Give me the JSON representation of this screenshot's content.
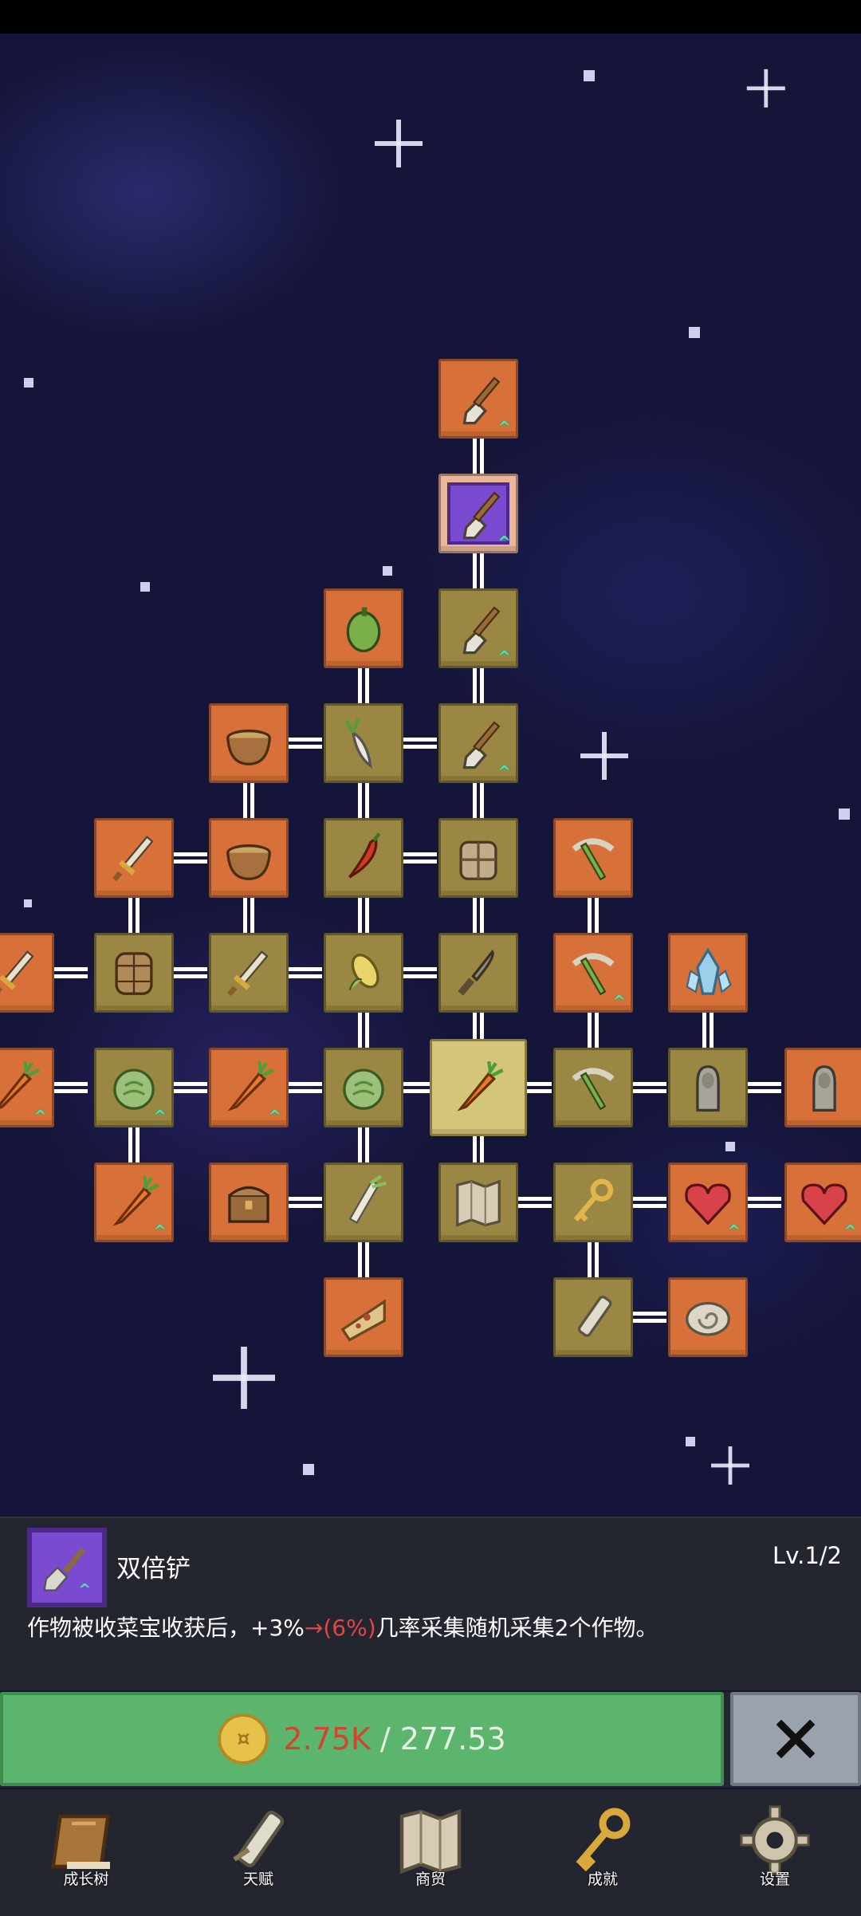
{
  "colors": {
    "node_orange": "#d8703a",
    "node_tan": "#9a8743",
    "node_selected": "#d5c57a",
    "node_purple": "#7a4ad0",
    "buy_green": "#5bb56d",
    "cost_red": "#d4432f",
    "highlight_red": "#e04646",
    "close_gray": "#9aa3ad"
  },
  "selected_skill": {
    "icon": "shovel-icon",
    "name": "双倍铲",
    "level": "Lv.1/2",
    "desc_prefix": "作物被收菜宝收获后，+3%",
    "desc_arrow": "→",
    "desc_highlight": "(6%)",
    "desc_suffix": "几率采集随机采集2个作物。"
  },
  "purchase": {
    "icon": "coin-icon",
    "owned": "2.75K",
    "separator": "/",
    "price": "277.53",
    "close_icon": "close-x-icon"
  },
  "nav": [
    {
      "label": "成长树",
      "icon": "book-icon"
    },
    {
      "label": "天赋",
      "icon": "scroll-icon"
    },
    {
      "label": "商贸",
      "icon": "map-icon"
    },
    {
      "label": "成就",
      "icon": "key-icon"
    },
    {
      "label": "设置",
      "icon": "gear-icon"
    }
  ],
  "tree_nodes": [
    {
      "icon": "shovel-icon",
      "color": "orange",
      "upgrade": true
    },
    {
      "icon": "shovel-icon",
      "color": "purple",
      "upgrade": true
    },
    {
      "icon": "pepper-icon",
      "color": "orange",
      "upgrade": false
    },
    {
      "icon": "shovel-icon",
      "color": "tan",
      "upgrade": true
    },
    {
      "icon": "bowl-icon",
      "color": "orange",
      "upgrade": false
    },
    {
      "icon": "radish-icon",
      "color": "tan",
      "upgrade": false
    },
    {
      "icon": "shovel-icon",
      "color": "tan",
      "upgrade": true
    },
    {
      "icon": "sword-icon",
      "color": "orange",
      "upgrade": false
    },
    {
      "icon": "bowl-icon",
      "color": "orange",
      "upgrade": false
    },
    {
      "icon": "chili-icon",
      "color": "tan",
      "upgrade": false
    },
    {
      "icon": "backpack-icon",
      "color": "tan",
      "upgrade": false
    },
    {
      "icon": "pickaxe-icon",
      "color": "orange",
      "upgrade": false
    },
    {
      "icon": "sword-icon",
      "color": "orange",
      "upgrade": false
    },
    {
      "icon": "barrel-icon",
      "color": "tan",
      "upgrade": false
    },
    {
      "icon": "sword-icon",
      "color": "tan",
      "upgrade": false
    },
    {
      "icon": "corn-icon",
      "color": "tan",
      "upgrade": false
    },
    {
      "icon": "knife-icon",
      "color": "tan",
      "upgrade": false
    },
    {
      "icon": "pickaxe-icon",
      "color": "orange",
      "upgrade": true
    },
    {
      "icon": "crystal-icon",
      "color": "orange",
      "upgrade": false
    },
    {
      "icon": "carrot-icon",
      "color": "orange",
      "upgrade": true
    },
    {
      "icon": "cabbage-icon",
      "color": "tan",
      "upgrade": true
    },
    {
      "icon": "carrot-icon",
      "color": "orange",
      "upgrade": true
    },
    {
      "icon": "cabbage-icon",
      "color": "tan",
      "upgrade": false
    },
    {
      "icon": "carrot-icon",
      "color": "selected",
      "upgrade": false
    },
    {
      "icon": "pickaxe-icon",
      "color": "tan",
      "upgrade": false
    },
    {
      "icon": "statue-icon",
      "color": "tan",
      "upgrade": false
    },
    {
      "icon": "statue-icon",
      "color": "orange",
      "upgrade": false
    },
    {
      "icon": "carrot-icon",
      "color": "orange",
      "upgrade": true
    },
    {
      "icon": "chest-icon",
      "color": "orange",
      "upgrade": false
    },
    {
      "icon": "leek-icon",
      "color": "tan",
      "upgrade": false
    },
    {
      "icon": "map-icon",
      "color": "tan",
      "upgrade": false
    },
    {
      "icon": "key-icon",
      "color": "tan",
      "upgrade": false
    },
    {
      "icon": "heart-icon",
      "color": "orange",
      "upgrade": true
    },
    {
      "icon": "heart-icon",
      "color": "orange",
      "upgrade": true
    },
    {
      "icon": "pizza-icon",
      "color": "orange",
      "upgrade": false
    },
    {
      "icon": "scroll-icon",
      "color": "tan",
      "upgrade": false
    },
    {
      "icon": "fossil-icon",
      "color": "orange",
      "upgrade": false
    }
  ]
}
